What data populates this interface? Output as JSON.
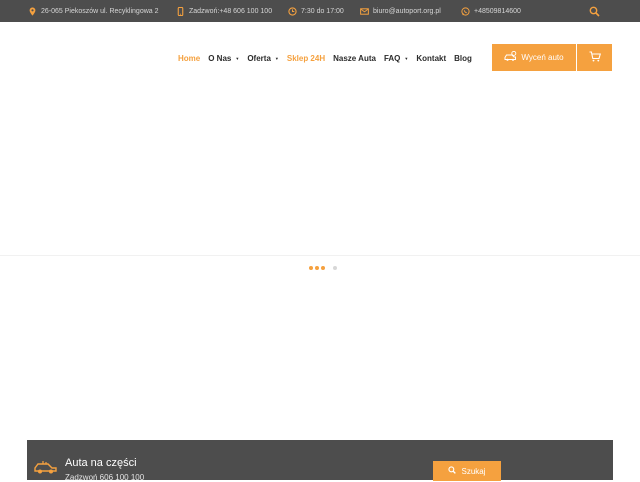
{
  "topbar": {
    "address": "26-065 Piekoszów ul. Recyklingowa 2",
    "phone": "Zadzwoń:+48 606 100 100",
    "hours": "7:30 do 17:00",
    "email": "biuro@autoport.org.pl",
    "whatsapp": "+48509814600",
    "icons": [
      "location-icon",
      "phone-icon",
      "clock-icon",
      "mail-icon",
      "whatsapp-icon",
      "search-icon"
    ]
  },
  "nav": {
    "items": [
      {
        "label": "Home",
        "active": true
      },
      {
        "label": "O Nas",
        "dropdown": true
      },
      {
        "label": "Oferta",
        "dropdown": true
      },
      {
        "label": "Sklep 24H",
        "highlight": true
      },
      {
        "label": "Nasze Auta"
      },
      {
        "label": "FAQ",
        "dropdown": true
      },
      {
        "label": "Kontakt"
      },
      {
        "label": "Blog"
      }
    ],
    "cta_label": "Wyceń auto",
    "icons": [
      "car-tag-icon",
      "cart-icon"
    ]
  },
  "bottom_bar": {
    "title": "Auta na części",
    "subtitle": "Zadzwoń 606 100 100",
    "search_label": "Szukaj",
    "icons": [
      "car-parts-icon",
      "search-icon"
    ]
  },
  "colors": {
    "accent": "#f5a13f",
    "topbar_bg": "#4d4d4d",
    "text_dark": "#2b2b2b"
  }
}
